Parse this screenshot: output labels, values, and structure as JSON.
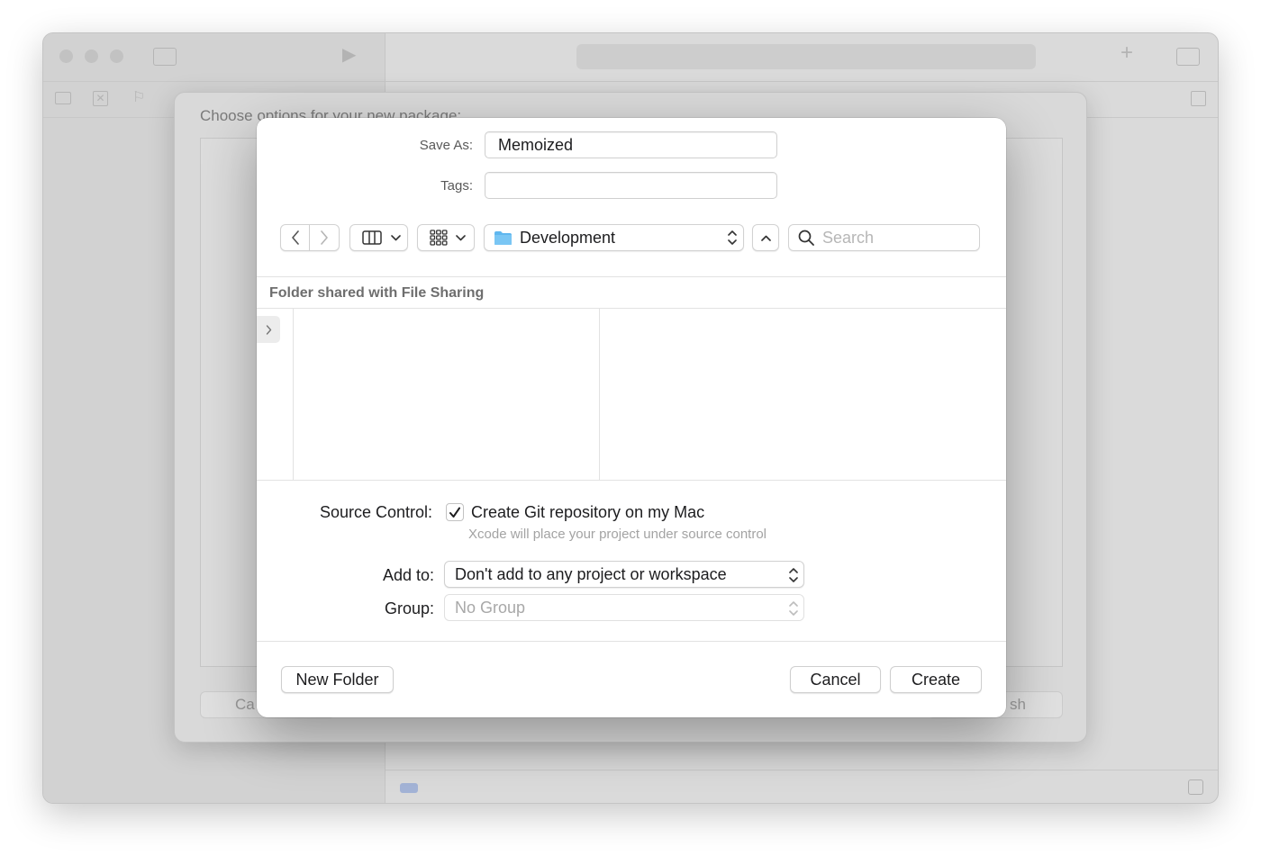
{
  "background_window": {
    "package_sheet_title": "Choose options for your new package:",
    "cancel_partial": "Ca",
    "finish_partial": "sh"
  },
  "save_dialog": {
    "save_as_label": "Save As:",
    "save_as_value": "Memoized",
    "tags_label": "Tags:",
    "tags_value": "",
    "location": "Development",
    "search_placeholder": "Search",
    "section_header": "Folder shared with File Sharing",
    "source_control_label": "Source Control:",
    "git_checkbox_label": "Create Git repository on my Mac",
    "git_checked": true,
    "git_help": "Xcode will place your project under source control",
    "add_to_label": "Add to:",
    "add_to_value": "Don't add to any project or workspace",
    "group_label": "Group:",
    "group_value": "No Group",
    "new_folder_button": "New Folder",
    "cancel_button": "Cancel",
    "create_button": "Create"
  },
  "colors": {
    "folder_blue": "#5fb7ef",
    "disabled_text": "#a8a8a8"
  }
}
